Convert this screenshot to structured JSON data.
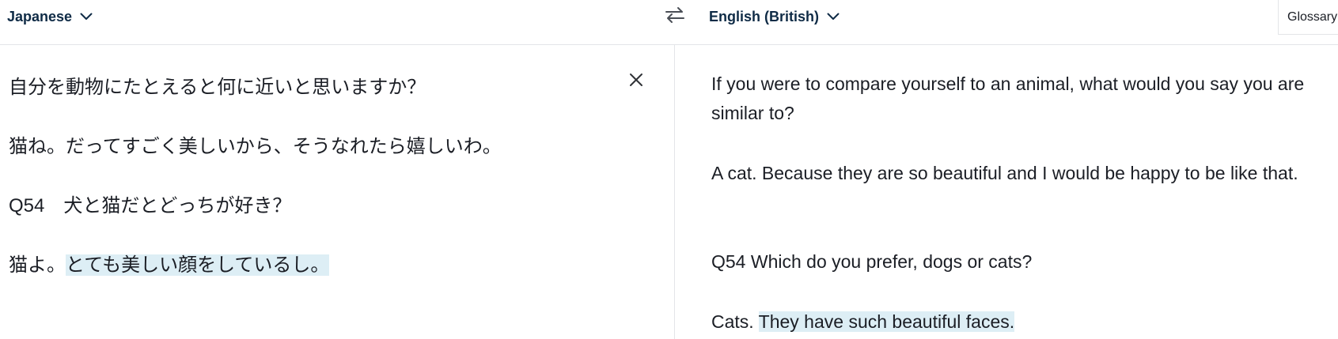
{
  "header": {
    "source_language": "Japanese",
    "target_language": "English (British)",
    "glossary_label": "Glossary"
  },
  "source": {
    "lines": [
      {
        "text": "自分を動物にたとえると何に近いと思いますか？"
      },
      {
        "text": "猫ね。だってすごく美しいから、そうなれたら嬉しいわ。"
      },
      {
        "text": "Q54　犬と猫だとどっちが好き？"
      },
      {
        "prefix": "猫よ。",
        "highlight": "とても美しい顔をしているし。"
      }
    ]
  },
  "target": {
    "paragraphs": [
      {
        "text": "If you were to compare yourself to an animal, what would you say you are similar to?"
      },
      {
        "text": "A cat. Because they are so beautiful and I would be happy to be like that."
      },
      {
        "text": "Q54 Which do you prefer, dogs or cats?"
      },
      {
        "prefix": "Cats. ",
        "highlight": "They have such beautiful faces."
      }
    ]
  },
  "icons": {
    "source_dropdown": "chevron-down-icon",
    "target_dropdown": "chevron-down-icon",
    "swap": "swap-arrows-icon",
    "clear": "close-icon"
  },
  "colors": {
    "language_label": "#0f2b46",
    "text": "#1b1e25",
    "highlight": "#ddeef5",
    "divider": "#e3e5e8"
  }
}
